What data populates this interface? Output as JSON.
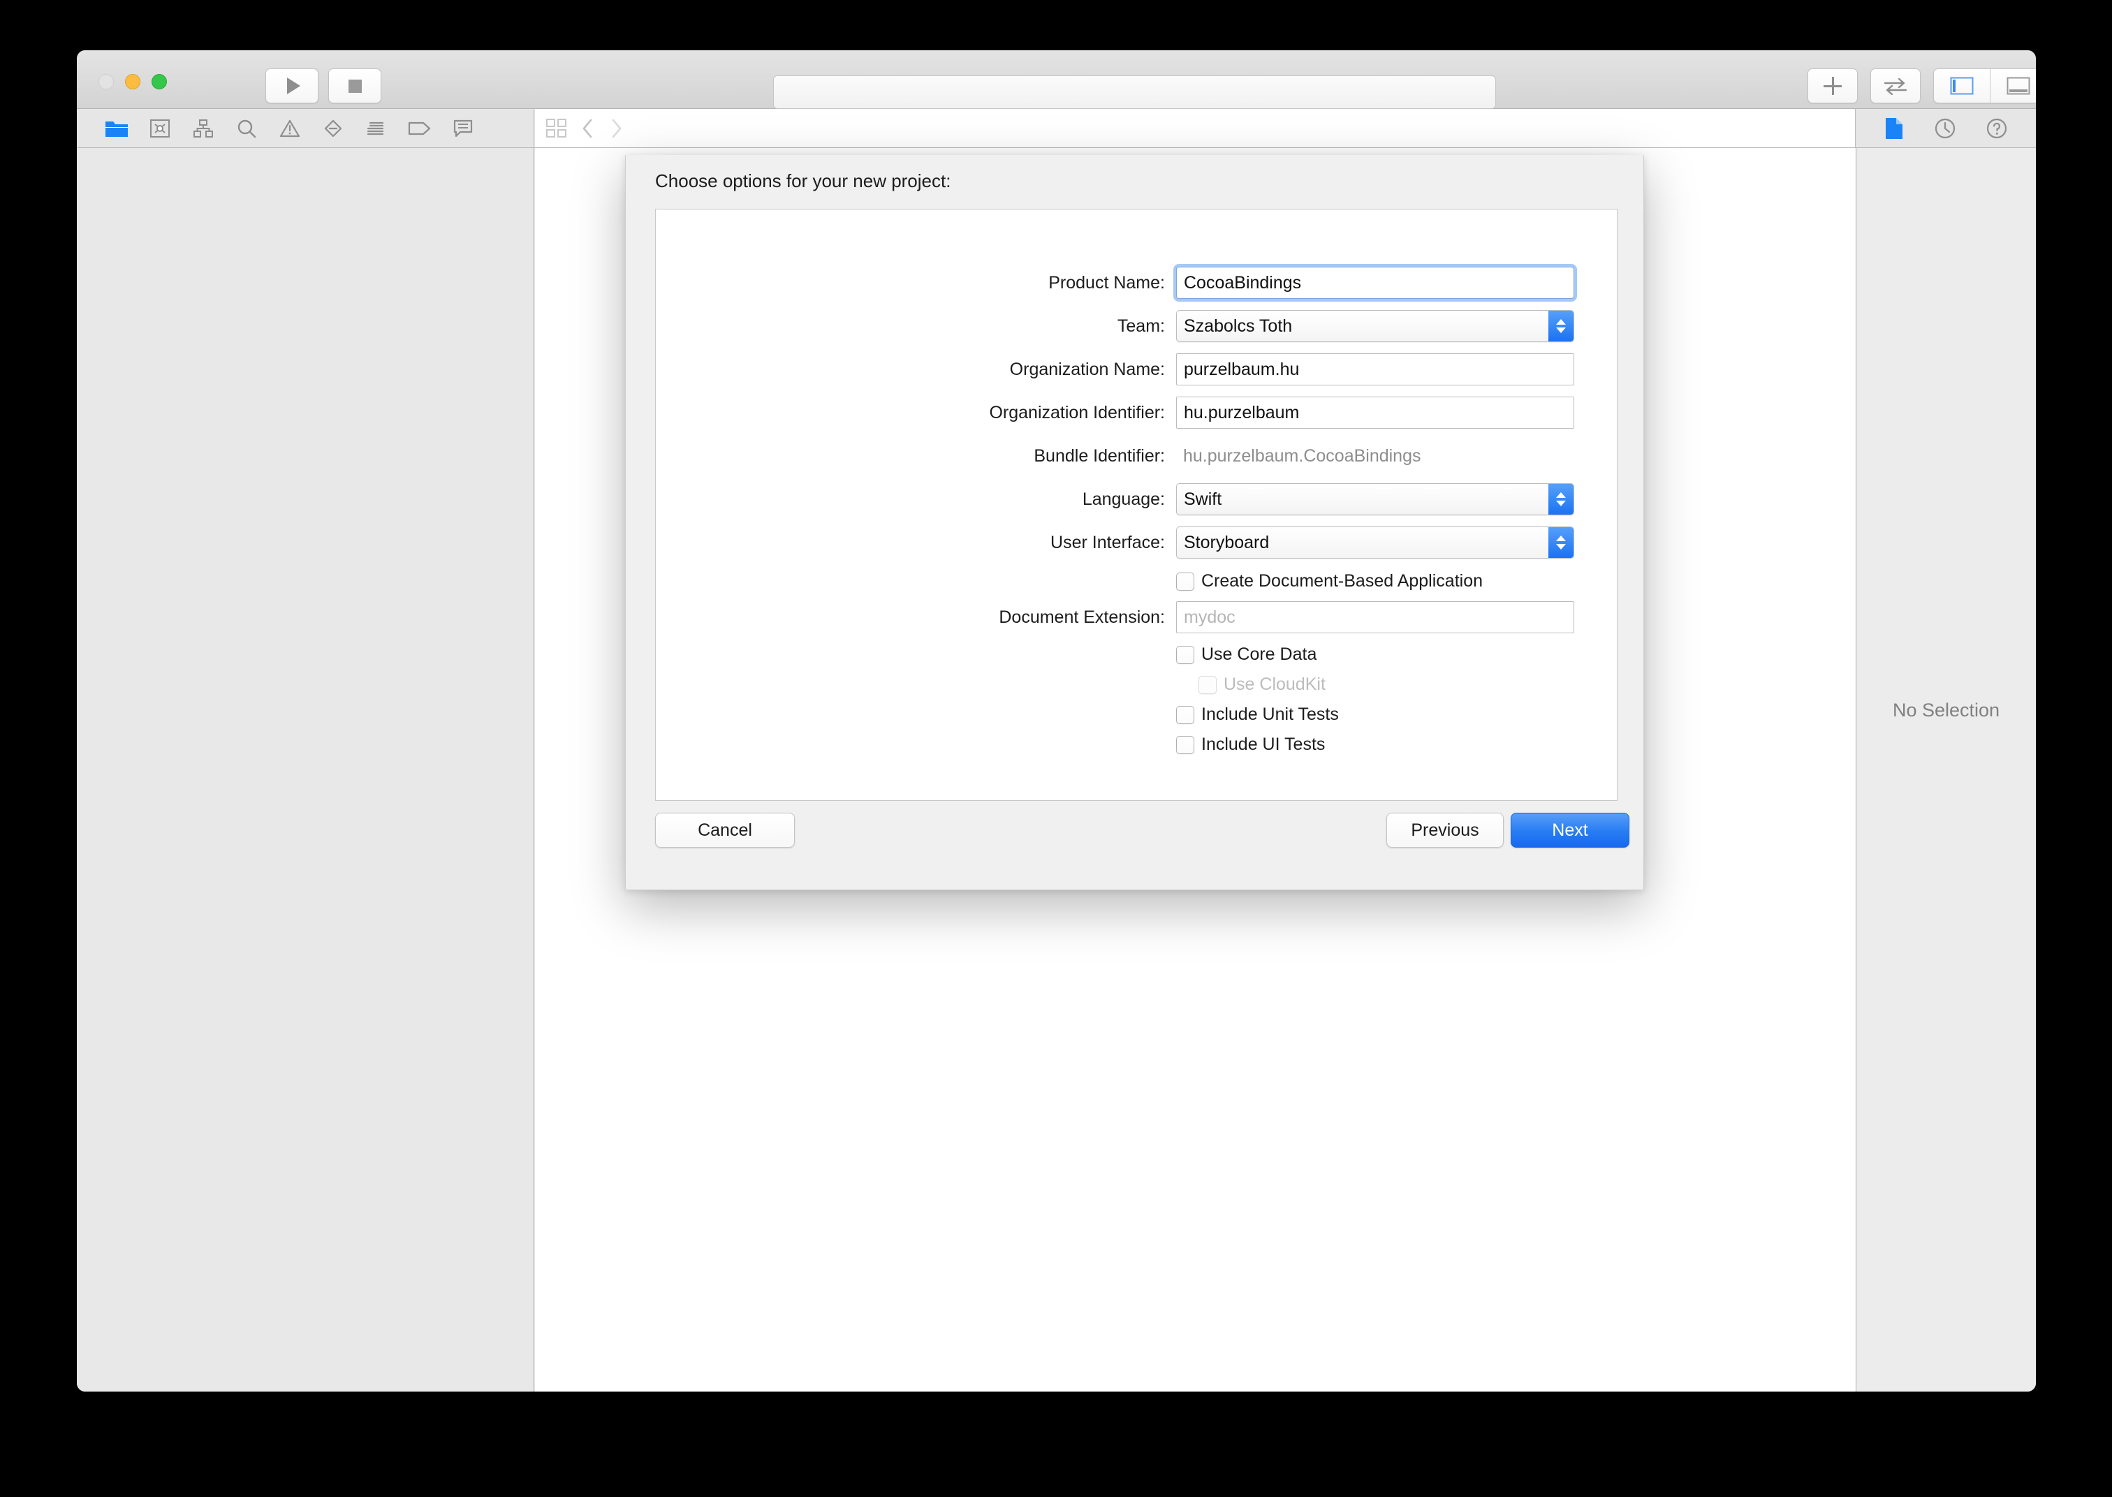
{
  "window": {
    "traffic_lights": [
      "close",
      "minimize",
      "zoom"
    ],
    "toolbar": {
      "run_label": "Run",
      "stop_label": "Stop",
      "add_label": "Add",
      "swap_label": "Swap",
      "editor_segments": [
        "standard-editor",
        "assistant-editor",
        "version-editor"
      ],
      "navigator_icons": [
        "project-navigator-icon",
        "source-control-navigator-icon",
        "symbol-navigator-icon",
        "find-navigator-icon",
        "issue-navigator-icon",
        "test-navigator-icon",
        "debug-navigator-icon",
        "breakpoint-navigator-icon",
        "report-navigator-icon"
      ],
      "inspector_icons": [
        "file-inspector-icon",
        "quick-help-inspector-icon",
        "help-icon"
      ],
      "jump_bar_icons": [
        "related-items-icon",
        "back-chevron-icon",
        "forward-chevron-icon"
      ]
    },
    "inspector": {
      "empty_state": "No Selection"
    }
  },
  "sheet": {
    "title": "Choose options for your new project:",
    "fields": [
      {
        "label": "Product Name:",
        "value": "CocoaBindings",
        "type": "text",
        "focused": true
      },
      {
        "label": "Team:",
        "value": "Szabolcs Toth",
        "type": "popup"
      },
      {
        "label": "Organization Name:",
        "value": "purzelbaum.hu",
        "type": "text"
      },
      {
        "label": "Organization Identifier:",
        "value": "hu.purzelbaum",
        "type": "text"
      },
      {
        "label": "Bundle Identifier:",
        "value": "hu.purzelbaum.CocoaBindings",
        "type": "static"
      },
      {
        "label": "Language:",
        "value": "Swift",
        "type": "popup"
      },
      {
        "label": "User Interface:",
        "value": "Storyboard",
        "type": "popup"
      }
    ],
    "document_based_checkbox": {
      "label": "Create Document-Based Application",
      "checked": false
    },
    "document_extension": {
      "label": "Document Extension:",
      "value": "",
      "placeholder": "mydoc"
    },
    "options": [
      {
        "label": "Use Core Data",
        "checked": false,
        "disabled": false,
        "indent": false
      },
      {
        "label": "Use CloudKit",
        "checked": false,
        "disabled": true,
        "indent": true
      },
      {
        "label": "Include Unit Tests",
        "checked": false,
        "disabled": false,
        "indent": false
      },
      {
        "label": "Include UI Tests",
        "checked": false,
        "disabled": false,
        "indent": false
      }
    ],
    "buttons": {
      "cancel": "Cancel",
      "previous": "Previous",
      "next": "Next"
    }
  },
  "colors": {
    "accent_blue": "#2a7ff3",
    "popup_arrow_blue": "#1b72f2",
    "focus_ring": "#5d9cec",
    "window_chrome": "#ececec",
    "navigator_bg": "#e8e8e8"
  }
}
